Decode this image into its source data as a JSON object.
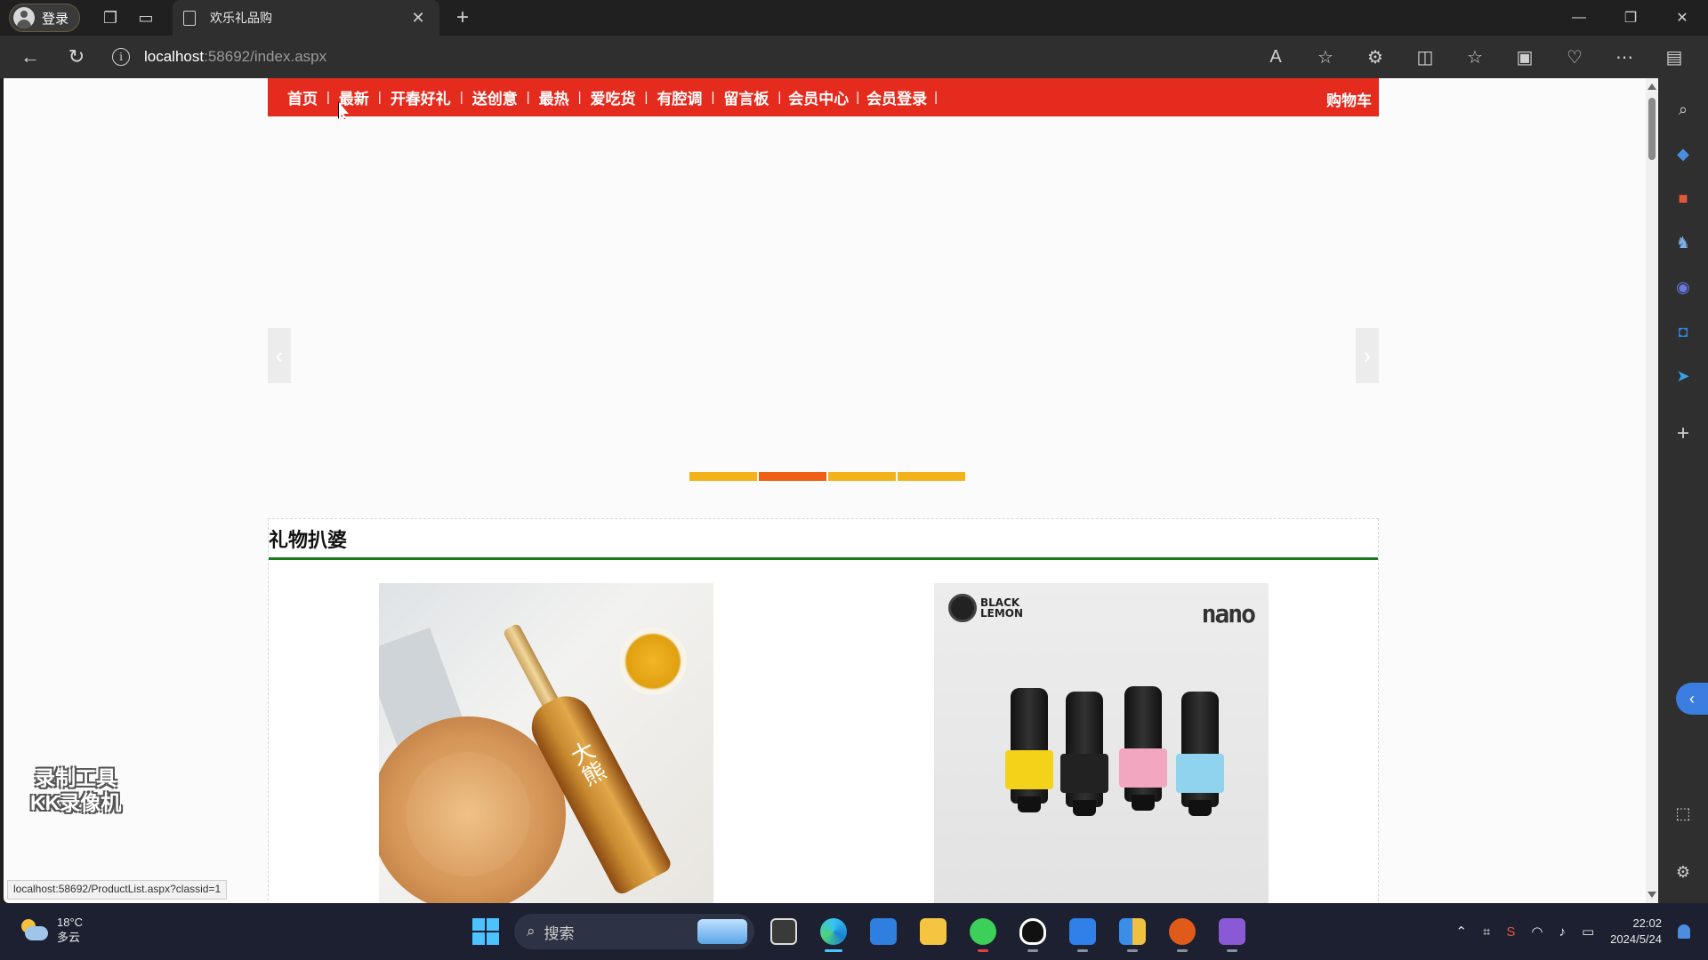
{
  "browser": {
    "profile_label": "登录",
    "tab_title": "欢乐礼品购",
    "url_host": "localhost",
    "url_path": ":58692/index.aspx",
    "window_controls": [
      "minimize-icon",
      "restore-icon",
      "close-icon"
    ]
  },
  "site": {
    "nav": [
      "首页",
      "最新",
      "开春好礼",
      "送创意",
      "最热",
      "爱吃货",
      "有腔调",
      "留言板",
      "会员中心",
      "会员登录"
    ],
    "cart_label": "购物车",
    "carousel": {
      "dot_count": 4,
      "active_index": 1
    },
    "section_title": "礼物扒婆",
    "products": [
      {
        "image_text": "大熊"
      },
      {
        "brand_text_1": "BLACK",
        "brand_text_2": "LEMON",
        "model_text": "nano"
      }
    ],
    "status_url": "localhost:58692/ProductList.aspx?classid=1",
    "watermark_line1": "录制工具",
    "watermark_line2": "KK录像机"
  },
  "taskbar": {
    "weather_temp": "18°C",
    "weather_desc": "多云",
    "search_placeholder": "搜索",
    "time": "22:02",
    "date": "2024/5/24",
    "apps": [
      "file-explorer-dark-icon",
      "edge-icon",
      "mail-icon",
      "folder-icon",
      "wechat-icon",
      "qq-icon",
      "todo-icon",
      "archive-icon",
      "game-icon",
      "visual-studio-icon"
    ]
  },
  "colors": {
    "nav_red": "#e52b1e",
    "carousel_dot": "#f3b21a",
    "carousel_dot_active": "#f05f16",
    "section_rule": "#1d7a1d"
  }
}
